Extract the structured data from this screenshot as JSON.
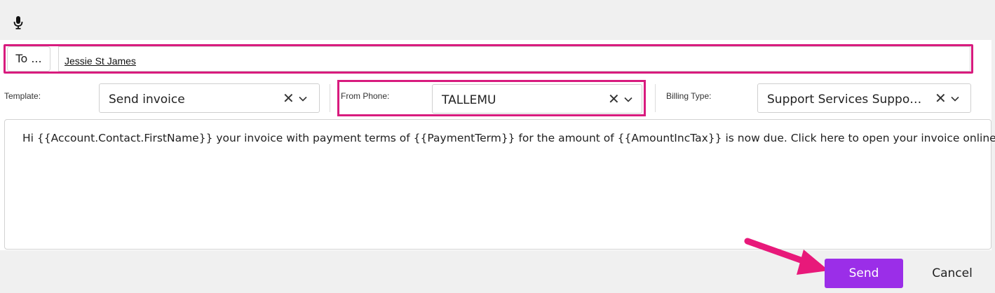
{
  "toolbar": {
    "mic_icon": "microphone-icon"
  },
  "recipient": {
    "to_label": "To ...",
    "value": "Jessie St James"
  },
  "fields": {
    "template": {
      "label": "Template:",
      "value": "Send invoice"
    },
    "from_phone": {
      "label": "From Phone:",
      "value": "TALLEMU"
    },
    "billing_type": {
      "label": "Billing Type:",
      "value": "Support Services Suppo…"
    }
  },
  "message": {
    "body": "Hi {{Account.Contact.FirstName}} your invoice with payment terms of {{PaymentTerm}} for the amount of {{AmountIncTax}} is now due. Click here to open your invoice online {{Url}}"
  },
  "actions": {
    "send_label": "Send",
    "cancel_label": "Cancel"
  },
  "colors": {
    "accent": "#9b2ee8",
    "highlight": "#d81b7e",
    "background": "#f0f0f0"
  }
}
